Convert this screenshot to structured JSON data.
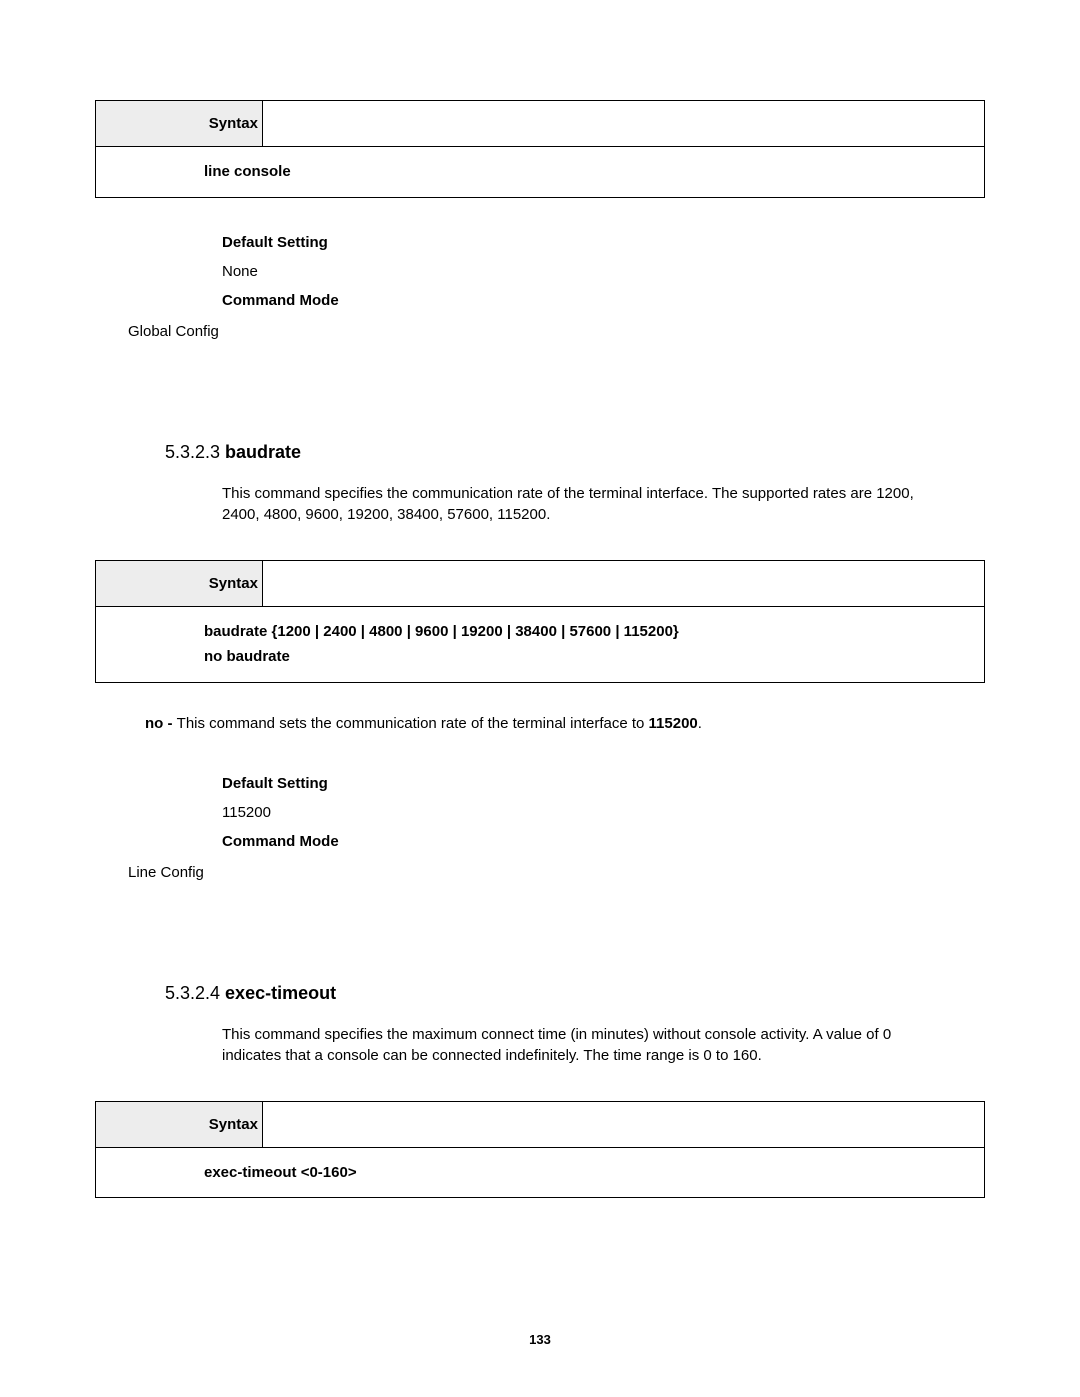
{
  "box1": {
    "syntax_label": "Syntax",
    "command": "line console"
  },
  "sec1_info": {
    "default_label": "Default Setting",
    "default_value": "None",
    "mode_label": "Command Mode",
    "mode_value": "Global Config"
  },
  "sec2": {
    "num": "5.3.2.3 ",
    "title": "baudrate",
    "desc": "This command specifies the communication rate of the terminal interface. The supported rates are 1200, 2400, 4800, 9600, 19200, 38400, 57600, 115200."
  },
  "box2": {
    "syntax_label": "Syntax",
    "line1": "baudrate {1200 | 2400 | 4800 | 9600 | 19200 | 38400 | 57600 | 115200}",
    "line2": "no baudrate"
  },
  "no_note": {
    "prefix": "no - ",
    "text": "This command sets the communication rate of the terminal interface to ",
    "value": "115200",
    "suffix": "."
  },
  "sec2_info": {
    "default_label": "Default Setting",
    "default_value": "115200",
    "mode_label": "Command Mode",
    "mode_value": "Line Config"
  },
  "sec3": {
    "num": "5.3.2.4 ",
    "title": "exec-timeout",
    "desc": "This command specifies the maximum connect time (in minutes) without console activity. A value of 0 indicates that a console can be connected indefinitely. The time range is 0 to 160."
  },
  "box3": {
    "syntax_label": "Syntax",
    "command": "exec-timeout <0-160>"
  },
  "page_number": "133"
}
